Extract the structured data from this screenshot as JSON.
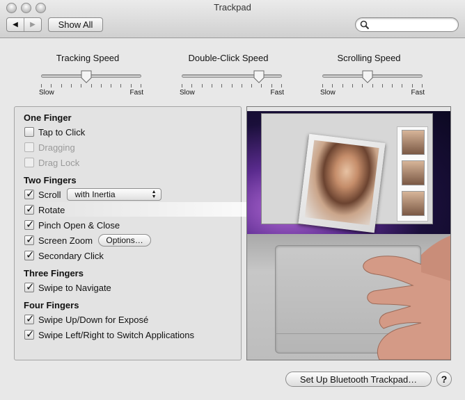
{
  "window": {
    "title": "Trackpad"
  },
  "toolbar": {
    "back_icon": "back-arrow-icon",
    "forward_icon": "forward-arrow-icon",
    "show_all_label": "Show All",
    "search_placeholder": ""
  },
  "sliders": [
    {
      "label": "Tracking Speed",
      "min_label": "Slow",
      "max_label": "Fast",
      "level": 0.45
    },
    {
      "label": "Double-Click Speed",
      "min_label": "Slow",
      "max_label": "Fast",
      "level": 0.77
    },
    {
      "label": "Scrolling Speed",
      "min_label": "Slow",
      "max_label": "Fast",
      "level": 0.45
    }
  ],
  "gestures": {
    "one_finger": {
      "heading": "One Finger",
      "tap_to_click": {
        "label": "Tap to Click",
        "checked": false,
        "enabled": true
      },
      "dragging": {
        "label": "Dragging",
        "checked": false,
        "enabled": false
      },
      "drag_lock": {
        "label": "Drag Lock",
        "checked": false,
        "enabled": false
      }
    },
    "two_fingers": {
      "heading": "Two Fingers",
      "scroll": {
        "label": "Scroll",
        "checked": true,
        "popup_value": "with Inertia"
      },
      "rotate": {
        "label": "Rotate",
        "checked": true
      },
      "pinch": {
        "label": "Pinch Open & Close",
        "checked": true
      },
      "screen_zoom": {
        "label": "Screen Zoom",
        "checked": true,
        "options_label": "Options…"
      },
      "secondary_click": {
        "label": "Secondary Click",
        "checked": true
      }
    },
    "three_fingers": {
      "heading": "Three Fingers",
      "swipe_navigate": {
        "label": "Swipe to Navigate",
        "checked": true
      }
    },
    "four_fingers": {
      "heading": "Four Fingers",
      "swipe_expose": {
        "label": "Swipe Up/Down for Exposé",
        "checked": true
      },
      "swipe_switch": {
        "label": "Swipe Left/Right to Switch Applications",
        "checked": true
      }
    }
  },
  "footer": {
    "setup_label": "Set Up Bluetooth Trackpad…",
    "help_label": "?"
  }
}
